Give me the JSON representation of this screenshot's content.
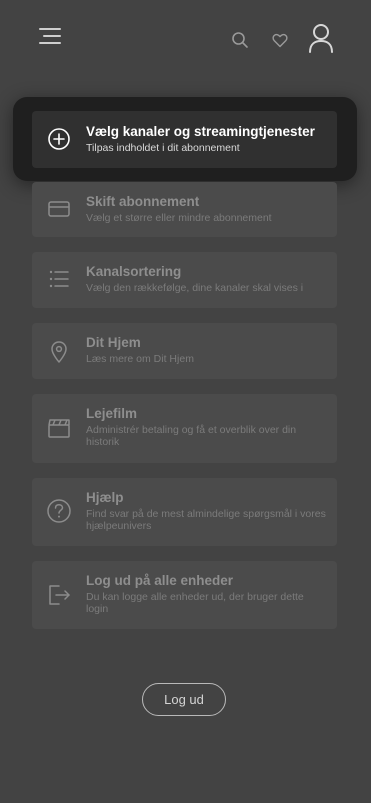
{
  "header": {
    "icons": [
      "menu-icon",
      "search-icon",
      "heart-icon",
      "user-icon"
    ]
  },
  "menu": {
    "items": [
      {
        "title": "Vælg kanaler og streamingtjenester",
        "subtitle": "Tilpas indholdet i dit abonnement",
        "icon": "plus-circle-icon",
        "active": true
      },
      {
        "title": "Skift abonnement",
        "subtitle": "Vælg et større eller mindre abonnement",
        "icon": "card-icon"
      },
      {
        "title": "Kanalsortering",
        "subtitle": "Vælg den rækkefølge, dine kanaler skal vises i",
        "icon": "list-icon"
      },
      {
        "title": "Dit Hjem",
        "subtitle": "Læs mere om Dit Hjem",
        "icon": "location-pin-icon"
      },
      {
        "title": "Lejefilm",
        "subtitle": "Administrér betaling og få et overblik over din historik",
        "icon": "clapperboard-icon"
      },
      {
        "title": "Hjælp",
        "subtitle": "Find svar på de mest almindelige spørgsmål i vores hjælpeunivers",
        "icon": "question-circle-icon"
      },
      {
        "title": "Log ud på alle enheder",
        "subtitle": "Du kan logge alle enheder ud, der bruger dette login",
        "icon": "logout-icon"
      }
    ]
  },
  "footer": {
    "logout_label": "Log ud"
  },
  "colors": {
    "background": "#434343",
    "card": "#4b4b4b",
    "active_card": "#303030",
    "active_frame": "#1f1f1f"
  }
}
